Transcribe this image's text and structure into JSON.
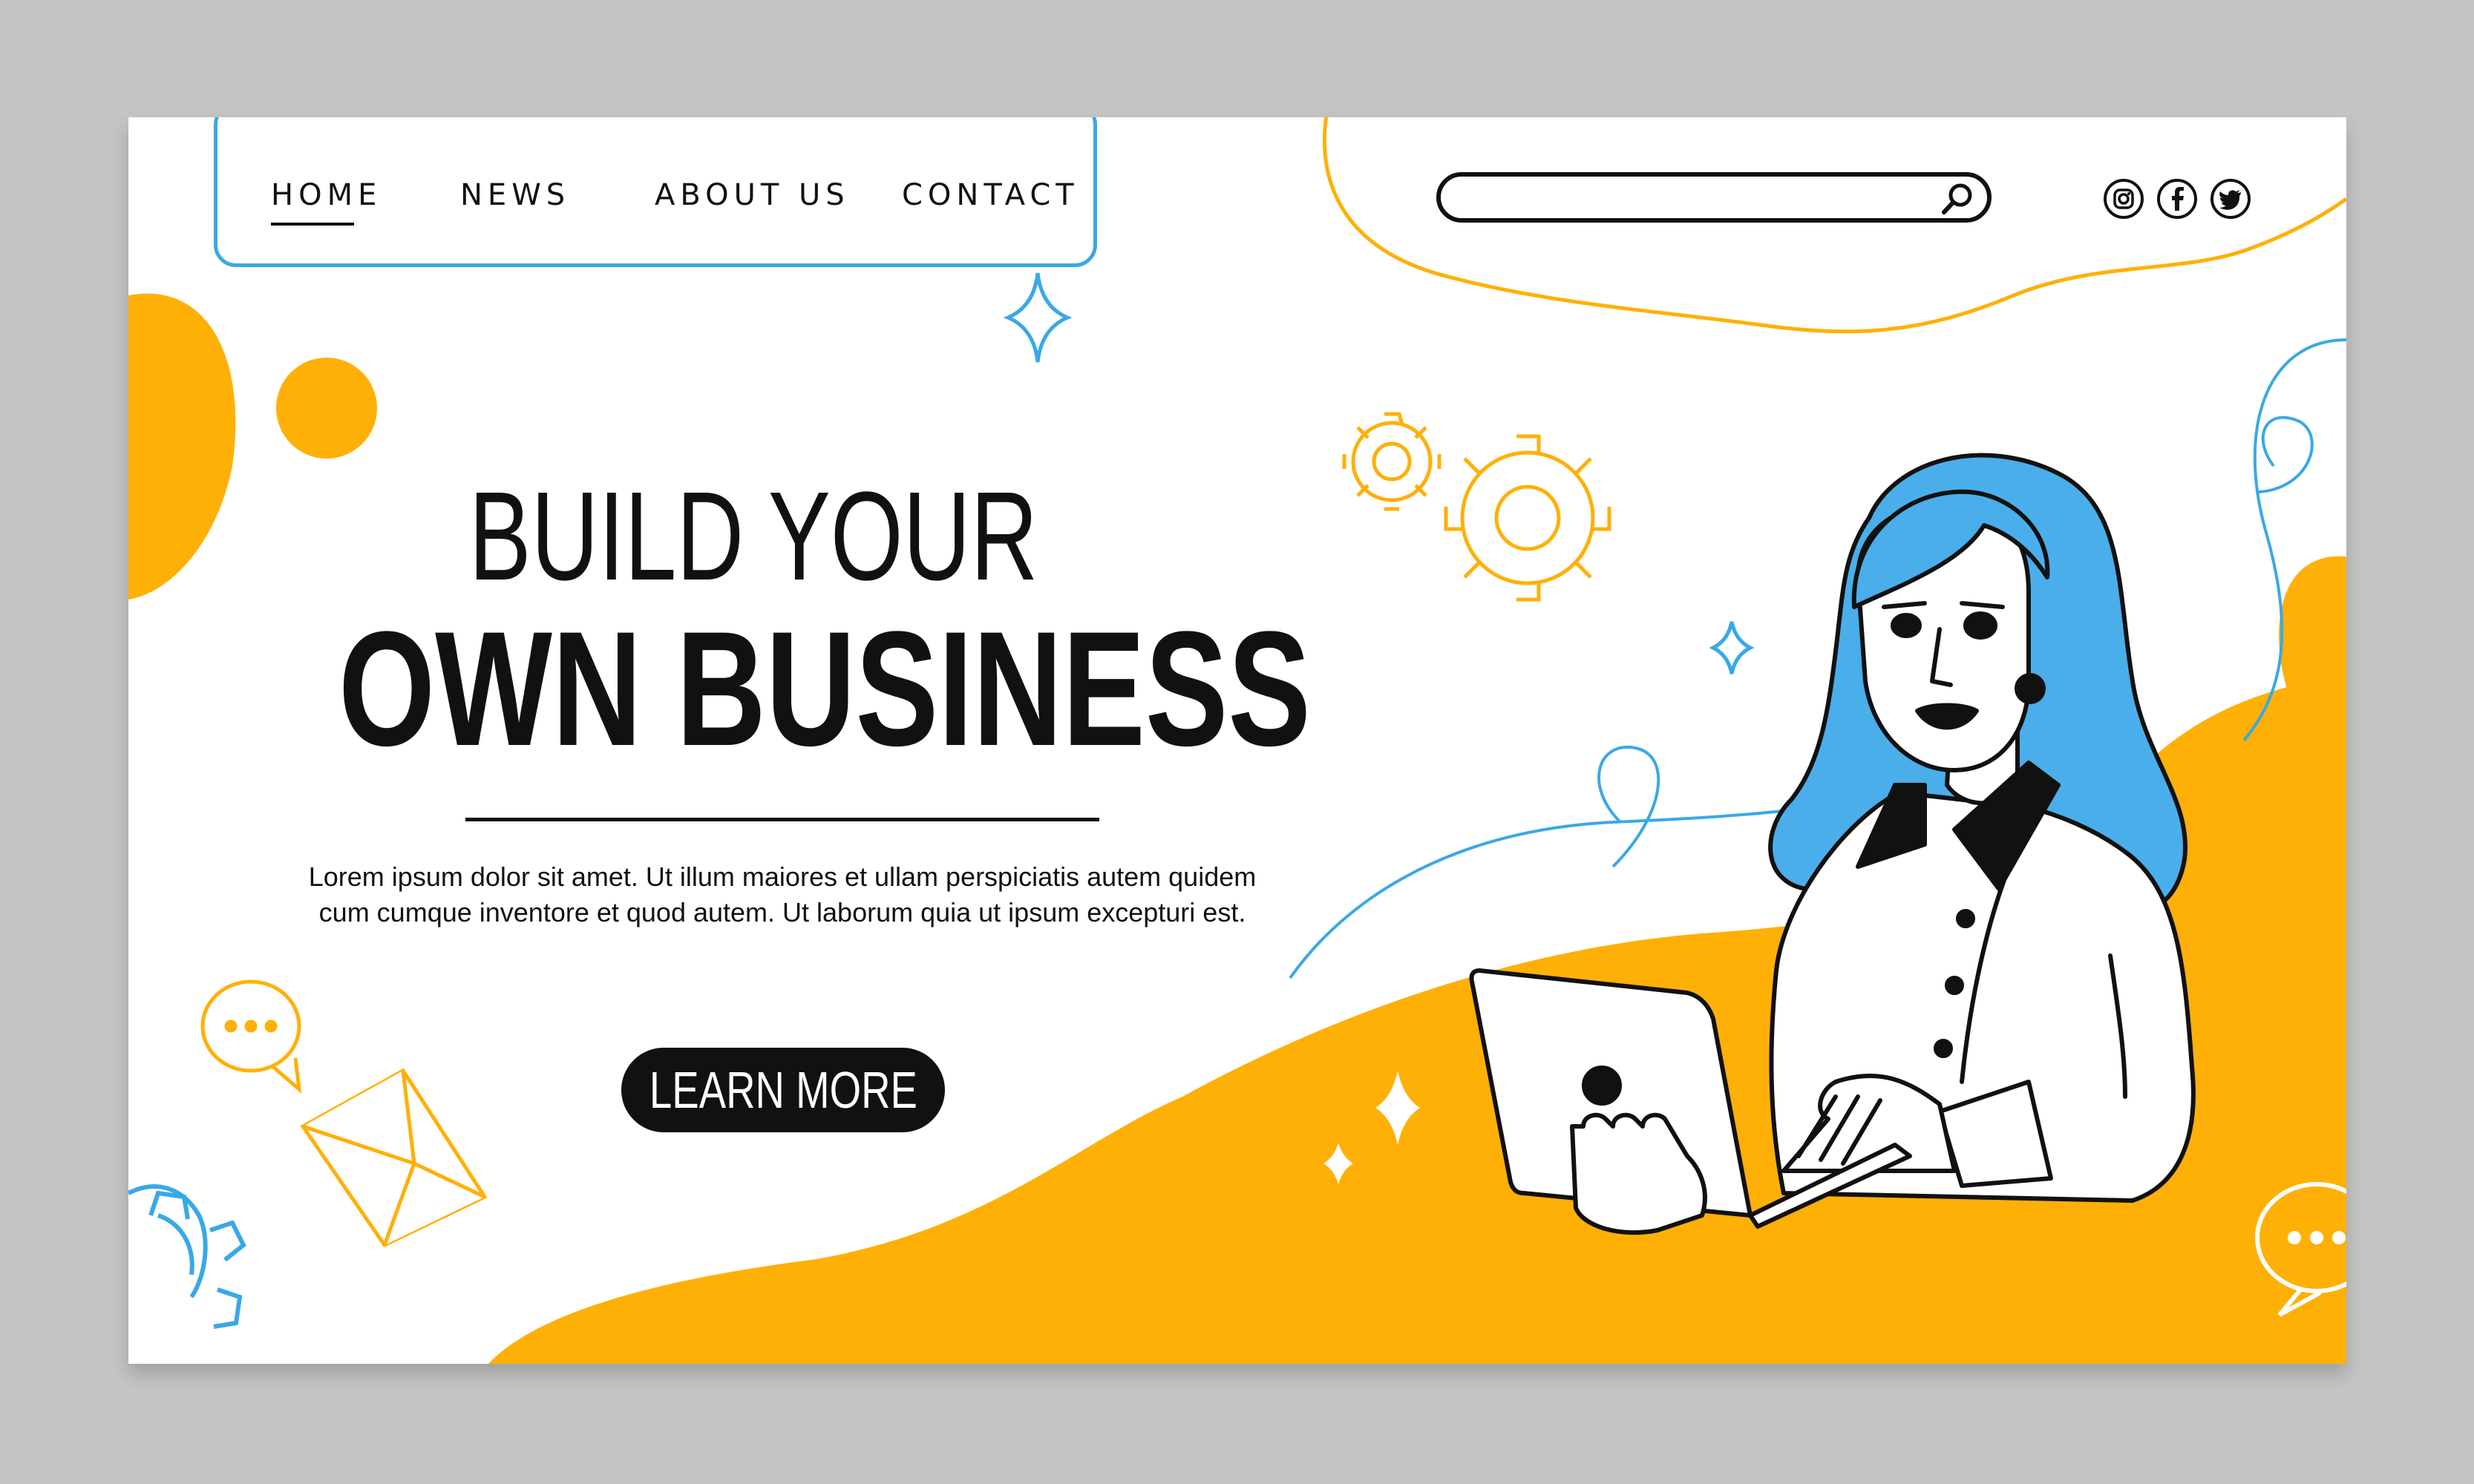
{
  "nav": {
    "items": [
      {
        "label": "HOME",
        "active": true
      },
      {
        "label": "NEWS"
      },
      {
        "label": "ABOUT US"
      },
      {
        "label": "CONTACT"
      }
    ]
  },
  "search": {
    "placeholder": "",
    "icon": "search-icon"
  },
  "social": [
    {
      "icon": "instagram-icon"
    },
    {
      "icon": "facebook-icon"
    },
    {
      "icon": "twitter-icon"
    }
  ],
  "hero": {
    "title_line1": "BUILD YOUR",
    "title_line2": "OWN BUSINESS",
    "body": "Lorem ipsum dolor sit amet. Ut illum maiores et ullam perspiciatis autem quidem cum cumque inventore et quod autem. Ut laborum quia ut ipsum excepturi est.",
    "cta_label": "LEARN MORE"
  },
  "illustration": {
    "subject": "woman-with-laptop",
    "decorations": [
      "gear-icon",
      "chat-bubble-icon",
      "envelope-icon",
      "sparkle-icon"
    ]
  },
  "colors": {
    "accent_orange": "#ffb007",
    "accent_blue": "#3aa8e6",
    "text_dark": "#111111",
    "page_bg": "#ffffff",
    "frame_bg": "#c4c4c4"
  }
}
